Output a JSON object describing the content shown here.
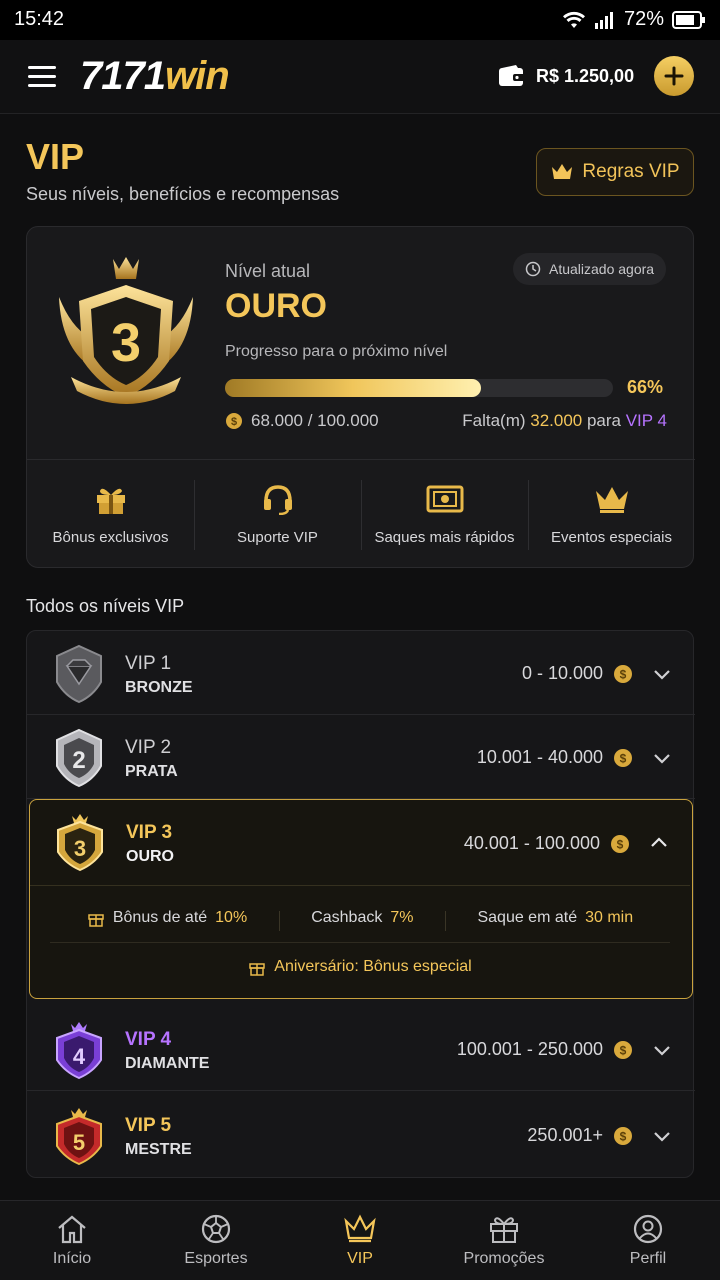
{
  "status": {
    "time": "15:42",
    "battery": "72%"
  },
  "header": {
    "logo_a": "7171",
    "logo_b": "win",
    "balance": "R$ 1.250,00"
  },
  "page": {
    "title": "VIP",
    "subtitle": "Seus níveis, benefícios e recompensas",
    "rules_label": "Regras VIP"
  },
  "current": {
    "label": "Nível atual",
    "level": "OURO",
    "badge_number": "3",
    "updated": "Atualizado agora",
    "progress_label": "Progresso para o próximo nível",
    "progress_pct": "66%",
    "progress_value": 0.66,
    "points": "68.000 / 100.000",
    "falta_a": "Falta(m) ",
    "falta_amount": "32.000",
    "falta_b": " para ",
    "falta_target": "VIP 4"
  },
  "benefits": [
    {
      "label": "Bônus exclusivos",
      "icon": "gift-icon"
    },
    {
      "label": "Suporte VIP",
      "icon": "headset-icon"
    },
    {
      "label": "Saques mais rápidos",
      "icon": "cash-icon"
    },
    {
      "label": "Eventos especiais",
      "icon": "crown-icon"
    }
  ],
  "levels_title": "Todos os níveis VIP",
  "levels": [
    {
      "vip": "VIP 1",
      "name": "BRONZE",
      "range": "0 - 10.000",
      "color": "#5a5a5e"
    },
    {
      "vip": "VIP 2",
      "name": "PRATA",
      "range": "10.001 - 40.000",
      "color": "#9a9aa0"
    },
    {
      "vip": "VIP 3",
      "name": "OURO",
      "range": "40.001 - 100.000",
      "color": "#d4a63c"
    },
    {
      "vip": "VIP 4",
      "name": "DIAMANTE",
      "range": "100.001 - 250.000",
      "color": "#8a4fe0"
    },
    {
      "vip": "VIP 5",
      "name": "MESTRE",
      "range": "250.001+",
      "color": "#c42a2a"
    }
  ],
  "details": {
    "bonus_a": "Bônus de até ",
    "bonus_v": "10%",
    "cash_a": "Cashback ",
    "cash_v": "7%",
    "saque_a": "Saque em até ",
    "saque_v": "30 min",
    "aniv": "Aniversário: Bônus especial"
  },
  "nav": [
    {
      "label": "Início",
      "icon": "home-icon"
    },
    {
      "label": "Esportes",
      "icon": "ball-icon"
    },
    {
      "label": "VIP",
      "icon": "crown-icon"
    },
    {
      "label": "Promoções",
      "icon": "gift-icon"
    },
    {
      "label": "Perfil",
      "icon": "user-icon"
    }
  ]
}
